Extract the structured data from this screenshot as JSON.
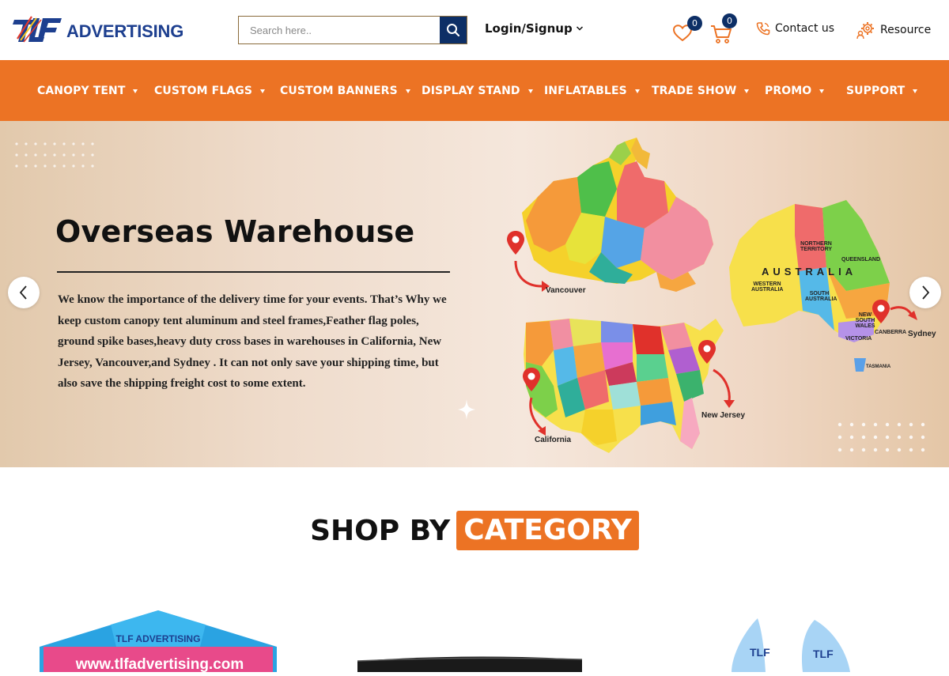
{
  "header": {
    "logo_text": "ADVERTISING",
    "logo_mark_text": "TLF",
    "search_placeholder": "Search here..",
    "login_label": "Login/Signup",
    "wishlist_count": "0",
    "cart_count": "0",
    "contact_label": "Contact us",
    "resource_label": "Resource"
  },
  "nav": {
    "items": [
      {
        "label": "CANOPY TENT"
      },
      {
        "label": "CUSTOM FLAGS"
      },
      {
        "label": "CUSTOM BANNERS"
      },
      {
        "label": "DISPLAY STAND"
      },
      {
        "label": "INFLATABLES"
      },
      {
        "label": "TRADE SHOW"
      },
      {
        "label": "PROMO"
      },
      {
        "label": "SUPPORT"
      }
    ]
  },
  "hero": {
    "title": "Overseas Warehouse",
    "body": "We know the importance of the delivery time for your events. That’s Why we keep custom canopy tent aluminum and steel frames,Feather flag poles, ground spike bases,heavy duty cross bases in warehouses in California, New Jersey, Vancouver,and Sydney . It can not only save your shipping time, but also save the shipping freight cost to some extent.",
    "map_labels": {
      "vancouver": "Vancouver",
      "california": "California",
      "new_jersey": "New Jersey",
      "australia": "AUSTRALIA",
      "sydney": "Sydney",
      "canberra": "CANBERRA",
      "northern_territory": "NORTHERN TERRITORY",
      "queensland": "QUEENSLAND",
      "western_australia": "WESTERN AUSTRALIA",
      "south_australia": "SOUTH AUSTRALIA",
      "new_south_wales": "NEW SOUTH WALES",
      "victoria": "VICTORIA",
      "tasmania": "TASMANIA"
    }
  },
  "section": {
    "title_black": "SHOP BY",
    "title_orange": "CATEGORY"
  },
  "categories": {
    "tent_banner_text": "www.tlfadvertising.com",
    "tent_logo_text": "TLF ADVERTISING"
  },
  "colors": {
    "brand_orange": "#ec7324",
    "brand_navy": "#0d2f66",
    "logo_blue": "#1d3f8f"
  }
}
